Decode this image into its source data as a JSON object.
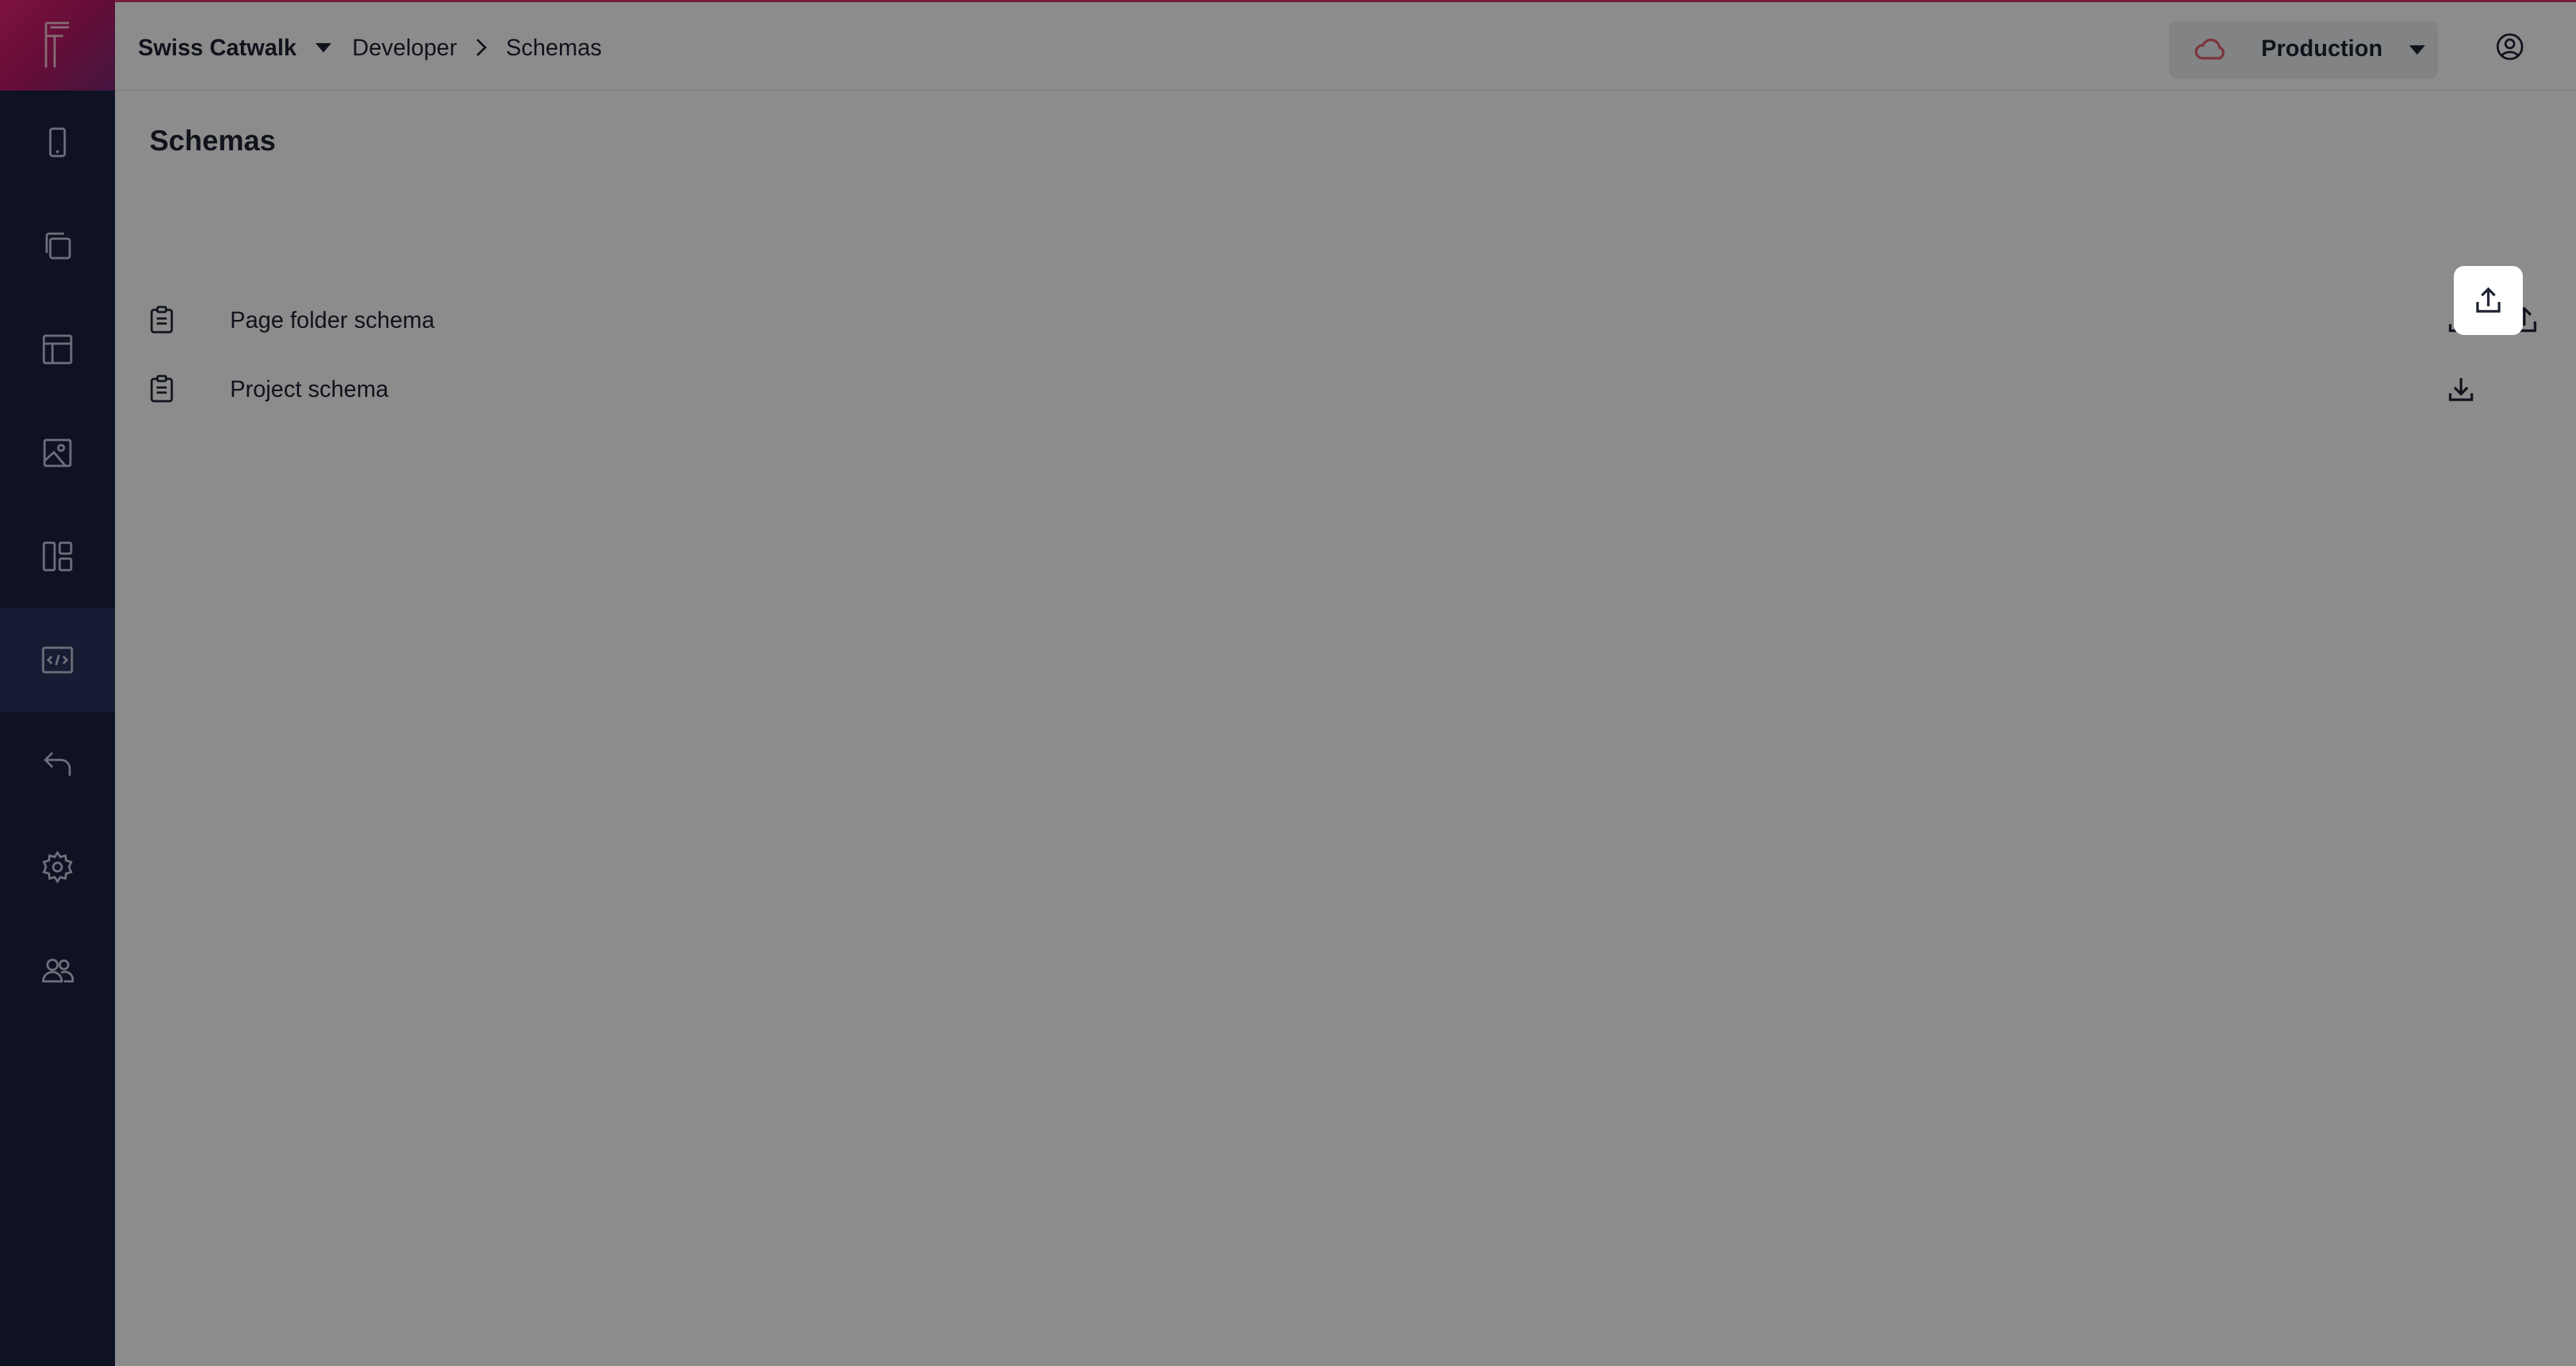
{
  "app": {
    "logo_letter": "F",
    "org_name": "Swiss Catwalk"
  },
  "breadcrumb": [
    "Developer",
    "Schemas"
  ],
  "environment": {
    "label": "Production",
    "status_color": "#e35d6a"
  },
  "sidebar": {
    "items": [
      {
        "icon": "mobile-icon"
      },
      {
        "icon": "copy-pages-icon"
      },
      {
        "icon": "layout-icon"
      },
      {
        "icon": "image-icon"
      },
      {
        "icon": "dashboard-icon"
      },
      {
        "icon": "code-icon",
        "active": true
      },
      {
        "icon": "undo-icon"
      },
      {
        "icon": "gear-icon"
      },
      {
        "icon": "users-icon"
      }
    ]
  },
  "main": {
    "title": "Schemas",
    "schemas": [
      {
        "label": "Page folder schema"
      },
      {
        "label": "Project schema"
      }
    ]
  },
  "colors": {
    "sidebar_bg": "#1b2140",
    "accent": "#d63a6e",
    "overlay": "rgba(0,0,0,0.45)"
  }
}
